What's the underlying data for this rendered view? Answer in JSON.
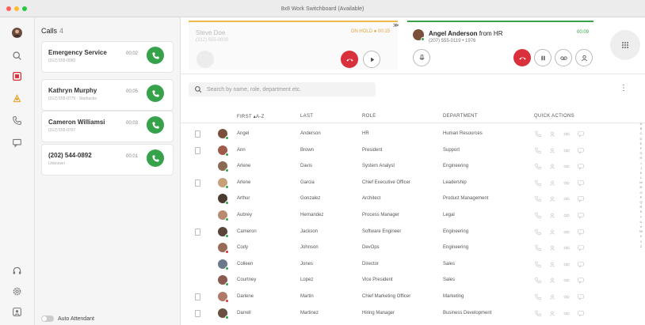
{
  "window": {
    "title": "8x8 Work Switchboard (Available)"
  },
  "rail": {
    "icons": [
      "user-avatar",
      "search-icon",
      "switchboard-icon",
      "contacts-icon",
      "phone-icon",
      "chat-icon",
      "headset-icon",
      "settings-icon",
      "profile-icon"
    ]
  },
  "calls": {
    "title": "Calls",
    "count": "4",
    "items": [
      {
        "name": "Emergency Service",
        "sub": "(312) 555-0060",
        "time": "00:02"
      },
      {
        "name": "Kathryn Murphy",
        "sub": "(312) 555-0779 · Starbucks",
        "time": "00:05"
      },
      {
        "name": "Cameron Williamsi",
        "sub": "(312) 555-0707",
        "time": "00:03"
      },
      {
        "name": "(202) 544-0892",
        "sub": "Unknown",
        "time": "00:01"
      }
    ],
    "auto_attendant": "Auto Attendant"
  },
  "pending_call": {
    "name": "Steve Doe",
    "number": "(312) 555-0000",
    "status": "ON HOLD ● 00:15"
  },
  "active_call": {
    "name": "Angel Anderson",
    "from": " from HR",
    "number": "(207) 555-0119 • 1976",
    "time": "00:09",
    "swap_label": "≫"
  },
  "search": {
    "placeholder": "Search by name, role, department etc."
  },
  "table": {
    "headers": {
      "first": "FIRST ▴A-Z",
      "last": "LAST",
      "role": "ROLE",
      "department": "DEPARTMENT",
      "quick_actions": "QUICK ACTIONS"
    },
    "rows": [
      {
        "first": "Angel",
        "last": "Anderson",
        "role": "HR",
        "department": "Human Resources",
        "doc": true,
        "avatar": "#7a4f3c",
        "status": "#36a24a"
      },
      {
        "first": "Ann",
        "last": "Brown",
        "role": "President",
        "department": "Support",
        "doc": true,
        "avatar": "#a05a4a",
        "status": "#36a24a"
      },
      {
        "first": "Arlene",
        "last": "Davis",
        "role": "System Analyst",
        "department": "Engineering",
        "doc": false,
        "avatar": "#8a6a55",
        "status": "#36a24a"
      },
      {
        "first": "Arlene",
        "last": "Garcia",
        "role": "Chief Executive Officer",
        "department": "Leadership",
        "doc": true,
        "avatar": "#c7a07a",
        "status": "#36a24a"
      },
      {
        "first": "Arthur",
        "last": "Gonzalez",
        "role": "Architect",
        "department": "Product Management",
        "doc": false,
        "avatar": "#4a3a30",
        "status": "#36a24a"
      },
      {
        "first": "Aubrey",
        "last": "Hernandez",
        "role": "Process Manager",
        "department": "Legal",
        "doc": false,
        "avatar": "#b88a70",
        "status": "#36a24a"
      },
      {
        "first": "Cameron",
        "last": "Jackson",
        "role": "Software Engineer",
        "department": "Engineering",
        "doc": true,
        "avatar": "#5a4538",
        "status": "#36a24a"
      },
      {
        "first": "Cody",
        "last": "Johnson",
        "role": "DevOps",
        "department": "Engineering",
        "doc": false,
        "avatar": "#9a6a58",
        "status": "#d9303b"
      },
      {
        "first": "Colleen",
        "last": "Jones",
        "role": "Director",
        "department": "Sales",
        "doc": false,
        "avatar": "#6a7a8a",
        "status": "#36a24a"
      },
      {
        "first": "Courtney",
        "last": "Lopez",
        "role": "Vice President",
        "department": "Sales",
        "doc": false,
        "avatar": "#8a5a50",
        "status": "#36a24a"
      },
      {
        "first": "Darlene",
        "last": "Martin",
        "role": "Chief Marketing Officer",
        "department": "Marketing",
        "doc": true,
        "avatar": "#b07a6a",
        "status": "#d9303b"
      },
      {
        "first": "Darrell",
        "last": "Martinez",
        "role": "Hiring Manager",
        "department": "Business Development",
        "doc": true,
        "avatar": "#6a5040",
        "status": "#36a24a"
      }
    ]
  },
  "alpha_index": [
    "A",
    "B",
    "C",
    "D",
    "E",
    "F",
    "G",
    "H",
    "I",
    "J",
    "K",
    "L",
    "M",
    "N",
    "O",
    "P",
    "Q",
    "R",
    "S",
    "T",
    "U",
    "V",
    "W",
    "X",
    "Y",
    "Z"
  ],
  "colors": {
    "accent_green": "#36a24a",
    "accent_red": "#d9303b",
    "hold_orange": "#f0b849"
  }
}
